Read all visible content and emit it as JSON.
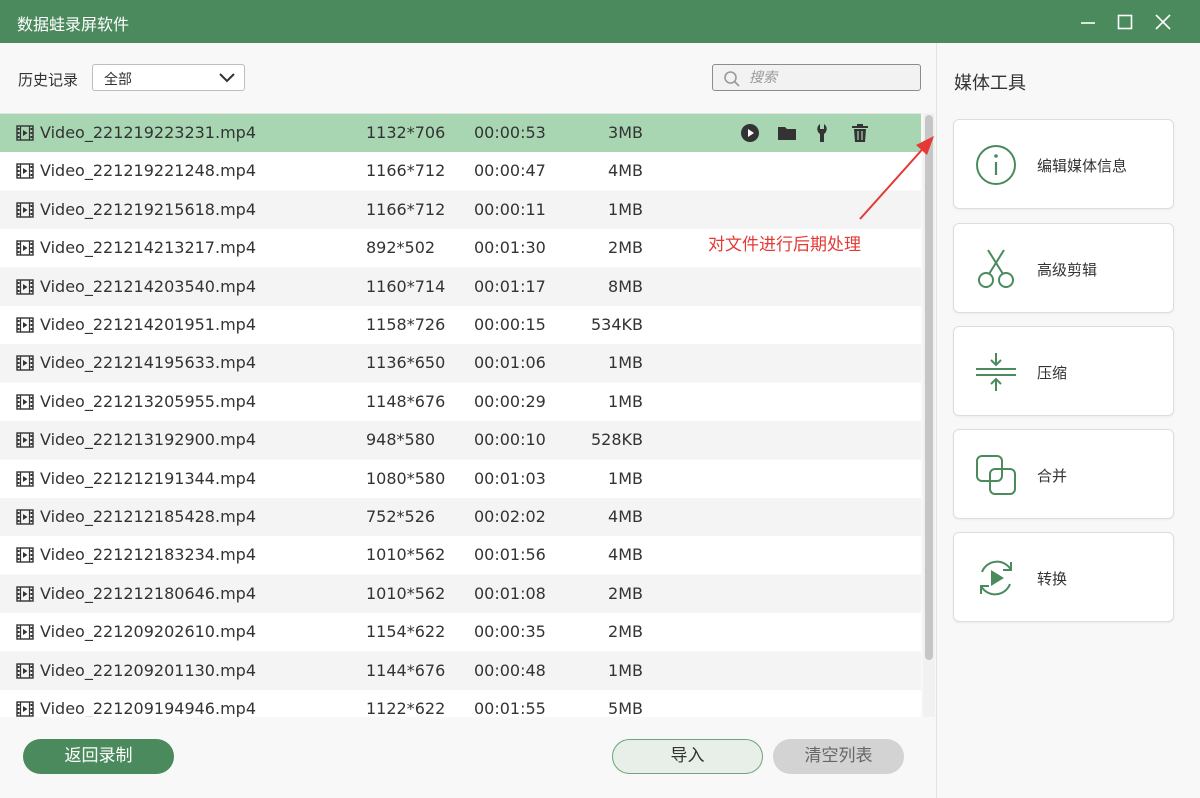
{
  "window": {
    "title": "数据蛙录屏软件"
  },
  "toolbar": {
    "history_label": "历史记录",
    "filter_value": "全部",
    "search_placeholder": "搜索"
  },
  "files": [
    {
      "name": "Video_221219223231.mp4",
      "resolution": "1132*706",
      "duration": "00:00:53",
      "size": "3MB"
    },
    {
      "name": "Video_221219221248.mp4",
      "resolution": "1166*712",
      "duration": "00:00:47",
      "size": "4MB"
    },
    {
      "name": "Video_221219215618.mp4",
      "resolution": "1166*712",
      "duration": "00:00:11",
      "size": "1MB"
    },
    {
      "name": "Video_221214213217.mp4",
      "resolution": "892*502",
      "duration": "00:01:30",
      "size": "2MB"
    },
    {
      "name": "Video_221214203540.mp4",
      "resolution": "1160*714",
      "duration": "00:01:17",
      "size": "8MB"
    },
    {
      "name": "Video_221214201951.mp4",
      "resolution": "1158*726",
      "duration": "00:00:15",
      "size": "534KB"
    },
    {
      "name": "Video_221214195633.mp4",
      "resolution": "1136*650",
      "duration": "00:01:06",
      "size": "1MB"
    },
    {
      "name": "Video_221213205955.mp4",
      "resolution": "1148*676",
      "duration": "00:00:29",
      "size": "1MB"
    },
    {
      "name": "Video_221213192900.mp4",
      "resolution": "948*580",
      "duration": "00:00:10",
      "size": "528KB"
    },
    {
      "name": "Video_221212191344.mp4",
      "resolution": "1080*580",
      "duration": "00:01:03",
      "size": "1MB"
    },
    {
      "name": "Video_221212185428.mp4",
      "resolution": "752*526",
      "duration": "00:02:02",
      "size": "4MB"
    },
    {
      "name": "Video_221212183234.mp4",
      "resolution": "1010*562",
      "duration": "00:01:56",
      "size": "4MB"
    },
    {
      "name": "Video_221212180646.mp4",
      "resolution": "1010*562",
      "duration": "00:01:08",
      "size": "2MB"
    },
    {
      "name": "Video_221209202610.mp4",
      "resolution": "1154*622",
      "duration": "00:00:35",
      "size": "2MB"
    },
    {
      "name": "Video_221209201130.mp4",
      "resolution": "1144*676",
      "duration": "00:00:48",
      "size": "1MB"
    },
    {
      "name": "Video_221209194946.mp4",
      "resolution": "1122*622",
      "duration": "00:01:55",
      "size": "5MB"
    }
  ],
  "selected_index": 0,
  "row_actions": [
    "play-icon",
    "folder-icon",
    "wrench-icon",
    "trash-icon"
  ],
  "annotation": "对文件进行后期处理",
  "footer": {
    "back_label": "返回录制",
    "import_label": "导入",
    "clear_label": "清空列表"
  },
  "media_tools": {
    "title": "媒体工具",
    "items": [
      {
        "label": "编辑媒体信息",
        "icon": "info-icon"
      },
      {
        "label": "高级剪辑",
        "icon": "scissors-icon"
      },
      {
        "label": "压缩",
        "icon": "compress-icon"
      },
      {
        "label": "合并",
        "icon": "merge-icon"
      },
      {
        "label": "转换",
        "icon": "convert-icon"
      }
    ]
  },
  "colors": {
    "brand": "#4a8a5c",
    "selected_row": "#a9d6b2",
    "annotation": "#e53935"
  }
}
